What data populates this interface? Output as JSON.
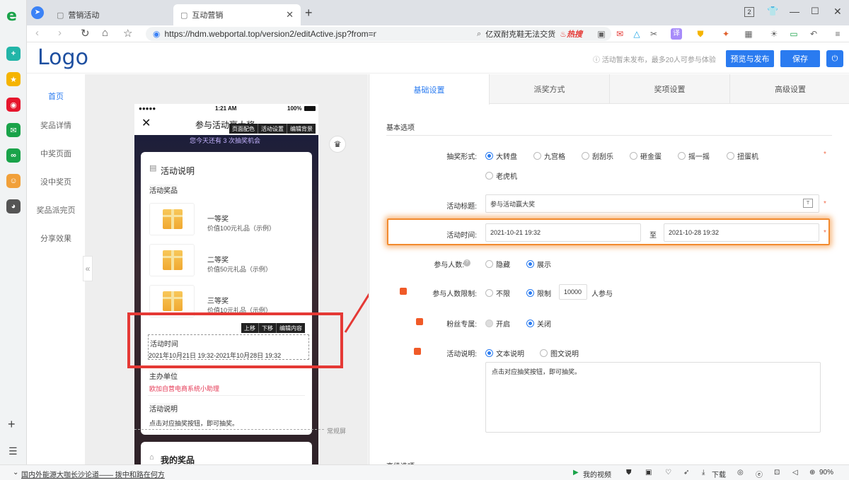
{
  "browser": {
    "tabs": [
      {
        "label": "营销活动"
      },
      {
        "label": "互动营销"
      }
    ],
    "url": "https://hdm.webportal.top/version2/editActive.jsp?from=new",
    "search_text": "亿双耐克鞋无法交货",
    "hot_label": "热搜",
    "tab_count": "2"
  },
  "header": {
    "logo": "Logo",
    "notice": "活动暂未发布，最多20人可参与体验",
    "preview_publish": "预览与发布",
    "save": "保存"
  },
  "nav": {
    "items": [
      "首页",
      "奖品详情",
      "中奖页面",
      "没中奖页",
      "奖品派完页",
      "分享效果"
    ]
  },
  "phone": {
    "carrier": "●●●●●",
    "time": "1:21 AM",
    "battery": "100%",
    "title": "参与活动赢大奖",
    "toolbar": [
      "页面配色",
      "活动设置",
      "编辑背景"
    ],
    "draws_banner": "您今天还有 3 次抽奖机会",
    "card_title": "活动说明",
    "prizes_label": "活动奖品",
    "prizes": [
      {
        "name": "一等奖",
        "value": "价值100元礼品（示例）"
      },
      {
        "name": "二等奖",
        "value": "价值50元礼品（示例）"
      },
      {
        "name": "三等奖",
        "value": "价值10元礼品（示例）"
      }
    ],
    "edit_toolbar": [
      "上移",
      "下移",
      "编辑内容"
    ],
    "time_label": "活动时间",
    "time_value": "2021年10月21日 19:32-2021年10月28日 19:32",
    "organizer_label": "主办单位",
    "organizer_value": "欧加自营电商系统小助理",
    "desc_label": "活动说明",
    "desc_value": "点击对应抽奖按钮，即可抽奖。",
    "screen_label": "常规屏",
    "my_prizes": "我的奖品"
  },
  "panel": {
    "tabs": [
      "基础设置",
      "派奖方式",
      "奖项设置",
      "高级设置"
    ],
    "section": "基本选项",
    "form_label": "抽奖形式:",
    "forms": [
      "大转盘",
      "九宫格",
      "刮刮乐",
      "砸金蛋",
      "摇一摇",
      "扭蛋机",
      "老虎机"
    ],
    "title_label": "活动标题:",
    "title_value": "参与活动赢大奖",
    "time_label": "活动时间:",
    "start": "2021-10-21 19:32",
    "to": "至",
    "end": "2021-10-28 19:32",
    "participants_label": "参与人数:",
    "participants_options": [
      "隐藏",
      "展示"
    ],
    "limit_label": "参与人数限制:",
    "limit_options": [
      "不限",
      "限制"
    ],
    "limit_value": "10000",
    "limit_suffix": "人参与",
    "fans_label": "粉丝专属:",
    "fans_options": [
      "开启",
      "关闭"
    ],
    "desc_label": "活动说明:",
    "desc_options": [
      "文本说明",
      "图文说明"
    ],
    "desc_value": "点击对应抽奖按钮，即可抽奖。",
    "next_section": "高级选项"
  },
  "statusbar": {
    "news": "国内外能源大咖长沙论道—— 拨中和路在何方",
    "video": "我的视频",
    "download": "下载",
    "zoom": "90%"
  },
  "colors": {
    "accent": "#2a7bf0",
    "highlight": "#f28a2e",
    "annotation": "#e53935"
  }
}
